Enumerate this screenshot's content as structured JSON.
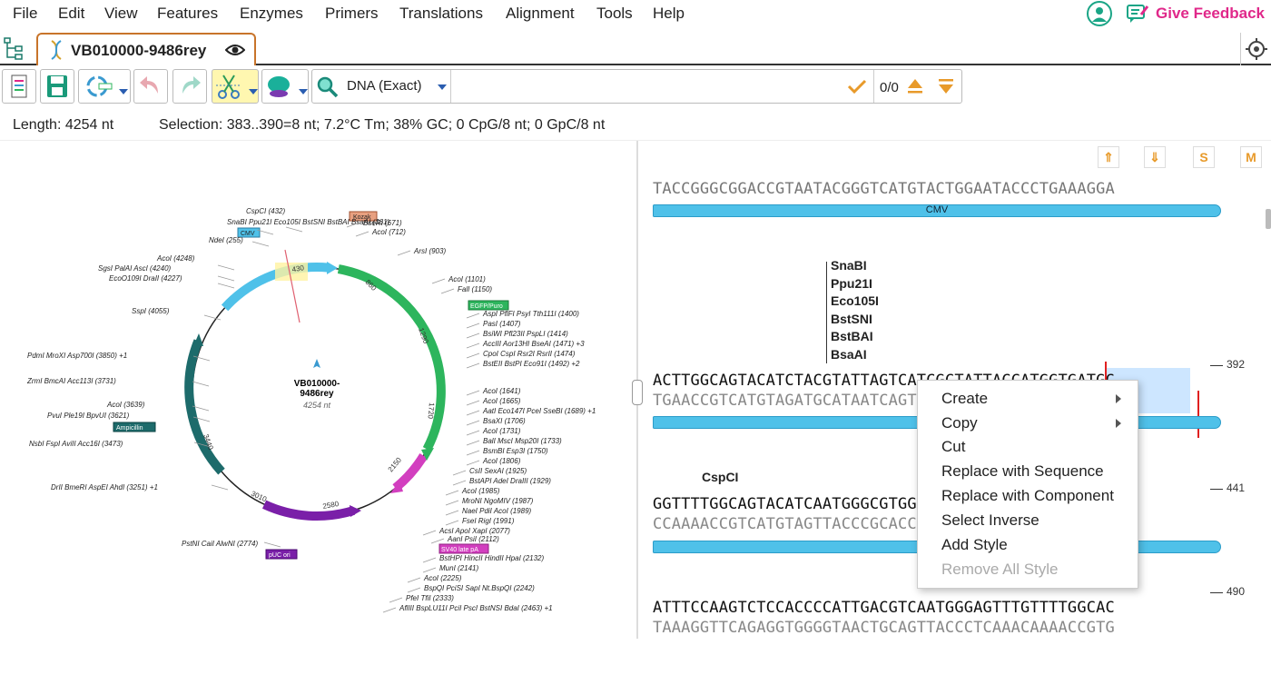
{
  "menu": [
    "File",
    "Edit",
    "View",
    "Features",
    "Enzymes",
    "Primers",
    "Translations",
    "Alignment",
    "Tools",
    "Help"
  ],
  "feedback_label": "Give Feedback",
  "tab": {
    "title": "VB010000-9486rey"
  },
  "search": {
    "mode": "DNA (Exact)",
    "counter": "0/0"
  },
  "status": {
    "length": "Length: 4254 nt",
    "selection": "Selection: 383..390=8 nt; 7.2°C Tm; 38% GC; 0 CpG/8 nt; 0 GpC/8 nt"
  },
  "map": {
    "name_line1": "VB010000-",
    "name_line2": "9486rey",
    "size": "4254 nt",
    "tick_labels": [
      "430",
      "860",
      "1290",
      "1720",
      "2150",
      "2580",
      "3010",
      "3440"
    ],
    "features": [
      "Kozak",
      "CMV",
      "EGFP/Puro",
      "SV40 late pA",
      "pUC ori",
      "Ampicillin"
    ],
    "sites_left": [
      {
        "t": "SnaBI  Ppu21I  Eco105I  BstSNI  BstBAI  BsaAI (361)"
      },
      {
        "t": "CspCI (432)"
      },
      {
        "t": "NdeI (255)"
      },
      {
        "t": "AcoI (4248)"
      },
      {
        "t": "SgsI  PalAI  AscI (4240)"
      },
      {
        "t": "EcoO109I  DraII (4227)"
      },
      {
        "t": "SspI (4055)"
      },
      {
        "t": "PdmI  MroXI  Asp700I (3850) +1"
      },
      {
        "t": "ZrmI  BmcAI  Acc113I (3731)"
      },
      {
        "t": "AcoI (3639)"
      },
      {
        "t": "PvuI  Ple19I  BpvUI (3621)"
      },
      {
        "t": "NsbI  FspI  AviII  Acc16I (3473)"
      },
      {
        "t": "DrII  BmeRI  AspEI  AhdI (3251) +1"
      },
      {
        "t": "PstNI  CaiI  AlwNI (2774)"
      }
    ],
    "sites_right": [
      {
        "t": "BseRI (671)"
      },
      {
        "t": "AcoI (712)"
      },
      {
        "t": "ArsI (903)"
      },
      {
        "t": "AcoI (1101)"
      },
      {
        "t": "FalI (1150)"
      },
      {
        "t": "AspI  PflFI  PsyI  Tth111I (1400)"
      },
      {
        "t": "PasI (1407)"
      },
      {
        "t": "BsiWI  Pfl23II  PspLI (1414)"
      },
      {
        "t": "AccIII  Aor13HI  BseAI (1471) +3"
      },
      {
        "t": "CpoI  CspI  Rsr2I  RsrII (1474)"
      },
      {
        "t": "BstEII  BstPI  Eco91I (1492) +2"
      },
      {
        "t": "AcoI (1641)"
      },
      {
        "t": "AcoI (1665)"
      },
      {
        "t": "AatI  Eco147I  PceI  SseBI (1689) +1"
      },
      {
        "t": "BsaXI (1706)"
      },
      {
        "t": "AcoI (1731)"
      },
      {
        "t": "BalI  MscI  Msp20I (1733)"
      },
      {
        "t": "BsmBI  Esp3I (1750)"
      },
      {
        "t": "AcoI (1806)"
      },
      {
        "t": "CsII  SexAI (1925)"
      },
      {
        "t": "BstAPI  AdeI  DraIII (1929)"
      },
      {
        "t": "AcoI (1985)"
      },
      {
        "t": "MroNI  NgoMIV (1987)"
      },
      {
        "t": "NaeI  PdiI  AcoI (1989)"
      },
      {
        "t": "FseI  RigI (1991)"
      },
      {
        "t": "AcsI  ApoI  XapI (2077)"
      },
      {
        "t": "AanI  PsiI (2112)"
      },
      {
        "t": "BstHPI  HincII  HindII  HpaI (2132)"
      },
      {
        "t": "MunI (2141)"
      },
      {
        "t": "AcoI (2225)"
      },
      {
        "t": "BspQI  PciSI  SapI  Nt.BspQI (2242)"
      },
      {
        "t": "PfeI  TfiI (2333)"
      },
      {
        "t": "AflIII  BspLU11I  PciI  PscI  BstNSI  BdaI (2463) +1"
      }
    ]
  },
  "seq": {
    "buttons": [
      "⇑",
      "⇓",
      "S",
      "M"
    ],
    "row0_top": "TACCGGGCGGACCGTAATACGGGTCATGTACTGGAATACCCTGAAAGGA",
    "row0_feature": "CMV",
    "enzymes": [
      "SnaBI",
      "Ppu21I",
      "Eco105I",
      "BstSNI",
      "BstBAI",
      "BsaAI"
    ],
    "row1_num": "392",
    "row1_top": "ACTTGGCAGTACATCTACGTATTAGTCATCGCTATTACCATGGTGATGC",
    "row1_bot": "TGAACCGTCATGTAGATGCATAATCAGTAGCGATAATGGTACCACTACG",
    "row2_enzyme": "CspCI",
    "row2_num": "441",
    "row2_top": "GGTTTTGGCAGTACATCAATGGGCGTGGATAGCGGTTTGACTCACGGGG",
    "row2_bot": "CCAAAACCGTCATGTAGTTACCCGCACCTATCGCCAAACTGAGTGCCCC",
    "row3_num": "490",
    "row3_top": "ATTTCCAAGTCTCCACCCCATTGACGTCAATGGGAGTTTGTTTTGGCAC",
    "row3_bot": "TAAAGGTTCAGAGGTGGGGTAACTGCAGTTACCCTCAAACAAAACCGTG"
  },
  "context_menu": {
    "items": [
      "Create",
      "Copy",
      "Cut",
      "Replace with Sequence",
      "Replace with Component",
      "Select Inverse",
      "Add Style",
      "Remove All Style"
    ]
  },
  "colors": {
    "cmv": "#4fc1e9",
    "egfp": "#2db55d",
    "sv40": "#d23fbf",
    "puc": "#7a1fa8",
    "amp": "#1d6b6b",
    "accent": "#e89a2a",
    "feedback": "#e0288a",
    "select": "#e02020"
  }
}
